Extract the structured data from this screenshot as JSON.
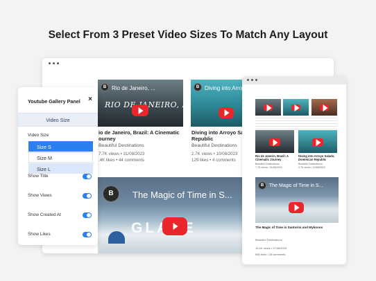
{
  "headline": "Select From 3 Preset Video Sizes To Match Any Layout",
  "big_window": {
    "videos": [
      {
        "overlay_title": "Rio de Janeiro, ...",
        "title": "Rio de Janeiro, Brazil: A Cinematic Journey",
        "title_visible": "io de Janeiro, Brazil: A Cinematic",
        "title_line2": "ourney",
        "channel": "Beautiful Destinations",
        "stats1": "7.7K views • 31/08/2023",
        "stats2": ".4K likes • 44 comments"
      },
      {
        "overlay_title": "Diving into Arro...",
        "title": "Diving into Arroyo Salad Republic",
        "title_visible": "Diving into Arroyo Salad",
        "title_line2": "Republic",
        "channel": "Beautiful Destinations",
        "stats1": "2.7K views • 10/08/2023",
        "stats2": "129 likes • 4 comments"
      }
    ],
    "featured": {
      "overlay_title": "The Magic of Time in S...",
      "badge_text": "GLACE"
    }
  },
  "panel": {
    "title": "Youtube Gallery Panel",
    "close": "×",
    "tab": "Video Size",
    "size_label": "Video Size",
    "options": [
      "Size S",
      "Size M",
      "Size L"
    ],
    "toggles": [
      {
        "label": "Show Title",
        "on": true
      },
      {
        "label": "Show Views",
        "on": true
      },
      {
        "label": "Show Created At",
        "on": true
      },
      {
        "label": "Show Likes",
        "on": true
      }
    ]
  },
  "small_window": {
    "mid_videos": [
      {
        "title": "Rio de Janeiro, Brazil: A Cinematic Journey",
        "channel": "Beautiful Destinations",
        "stats": "7.7K views • 31/08/2023"
      },
      {
        "title": "Diving into Arroyo Salado, Dominican Republic",
        "channel": "Beautiful Destinations",
        "stats": "2.7K views • 10/08/2023"
      }
    ],
    "featured": {
      "overlay_title": "The Magic of Time in S...",
      "title": "The Magic of Time in Santorini and Mykonos",
      "channel": "Beautiful Destinations",
      "stats1": "14.6K views • 27/06/2023",
      "stats2": "555 likes • 28 comments"
    }
  }
}
